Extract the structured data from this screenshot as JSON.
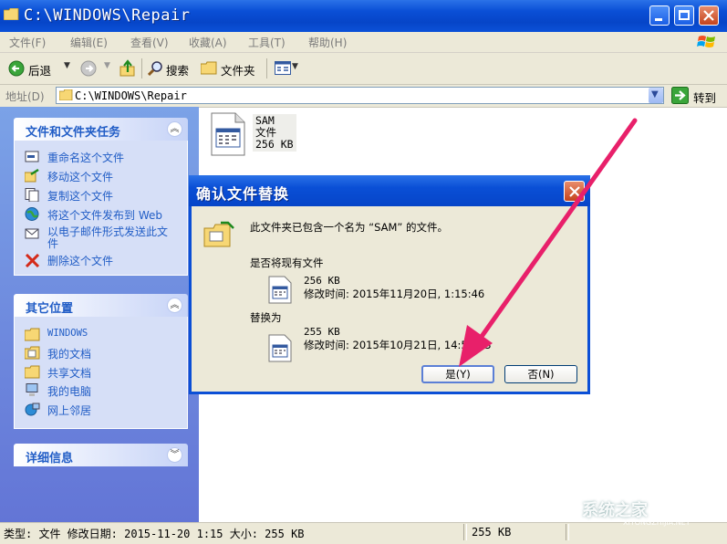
{
  "window": {
    "title": "C:\\WINDOWS\\Repair"
  },
  "menu": [
    "文件(F)",
    "编辑(E)",
    "查看(V)",
    "收藏(A)",
    "工具(T)",
    "帮助(H)"
  ],
  "toolbar": {
    "back_label": "后退",
    "search_label": "搜索",
    "folders_label": "文件夹"
  },
  "address": {
    "label": "地址(D)",
    "value": "C:\\WINDOWS\\Repair",
    "go_label": "转到"
  },
  "tasks_panel": {
    "title": "文件和文件夹任务",
    "items": [
      "重命名这个文件",
      "移动这个文件",
      "复制这个文件",
      "将这个文件发布到 Web",
      "以电子邮件形式发送此文件",
      "删除这个文件"
    ]
  },
  "places_panel": {
    "title": "其它位置",
    "items": [
      "WINDOWS",
      "我的文档",
      "共享文档",
      "我的电脑",
      "网上邻居"
    ]
  },
  "details_panel": {
    "title": "详细信息"
  },
  "file": {
    "name": "SAM",
    "type": "文件",
    "size": "256 KB"
  },
  "dialog": {
    "title": "确认文件替换",
    "message": "此文件夹已包含一个名为 “SAM” 的文件。",
    "question": "是否将现有文件",
    "existing_size": "256 KB",
    "existing_modified": "修改时间: 2015年11月20日, 1:15:46",
    "replace_label": "替换为",
    "new_size": "255 KB",
    "new_modified": "修改时间: 2015年10月21日, 14:53:13",
    "yes_label": "是(Y)",
    "no_label": "否(N)"
  },
  "status": {
    "details": "类型: 文件 修改日期: 2015-11-20 1:15 大小: 255 KB",
    "size": "255 KB"
  },
  "watermark": {
    "text": "系统之家",
    "url": "XITONGZHIJIA.NET"
  },
  "colors": {
    "titlebar": "#0a4fd6",
    "task_link": "#215dc6",
    "annotation_arrow": "#e8206a"
  }
}
